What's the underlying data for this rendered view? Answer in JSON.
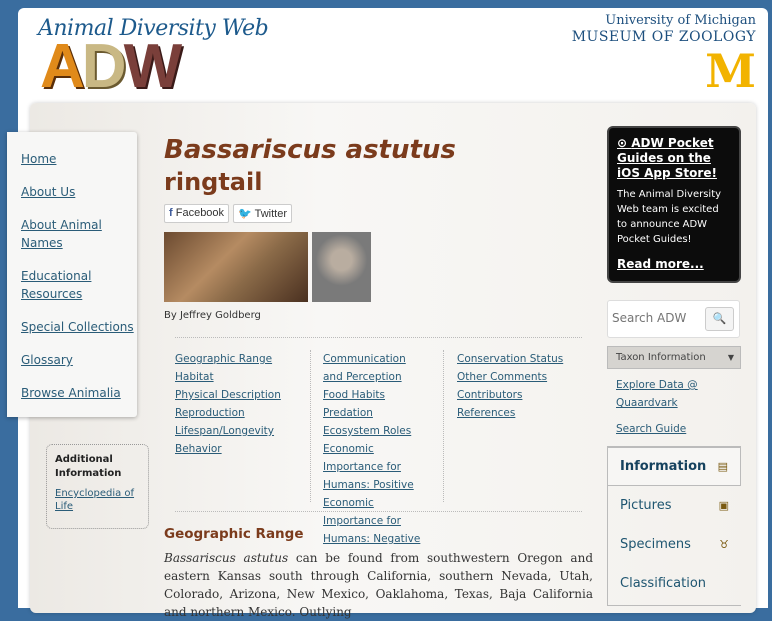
{
  "header": {
    "site_title": "Animal Diversity Web",
    "logo_letters": [
      "A",
      "D",
      "W"
    ],
    "university": "University of Michigan",
    "museum": "MUSEUM OF ZOOLOGY",
    "m_logo": "M"
  },
  "nav": [
    "Home",
    "About Us",
    "About Animal Names",
    "Educational Resources",
    "Special Collections",
    "Glossary",
    "Browse Animalia"
  ],
  "additional": {
    "title": "Additional Information",
    "link": "Encyclopedia of Life"
  },
  "species": {
    "scientific": "Bassariscus astutus",
    "common": "ringtail",
    "share": [
      "Facebook",
      "Twitter"
    ],
    "credit": "By Jeffrey Goldberg"
  },
  "toc": {
    "col1": [
      "Geographic Range",
      "Habitat",
      "Physical Description",
      "Reproduction",
      "Lifespan/Longevity",
      "Behavior"
    ],
    "col2": [
      "Communication and Perception",
      "Food Habits",
      "Predation",
      "Ecosystem Roles",
      "Economic Importance for Humans: Positive",
      "Economic Importance for Humans: Negative"
    ],
    "col3": [
      "Conservation Status",
      "Other Comments",
      "Contributors",
      "References"
    ]
  },
  "section": {
    "title": "Geographic Range",
    "lead": "Bassariscus astutus",
    "text": " can be found from southwestern Oregon and eastern Kansas south through California, southern Nevada, Utah, Colorado, Arizona, New Mexico, Oaklahoma, Texas, Baja California and northern Mexico. Outlying"
  },
  "promo": {
    "title": "ADW Pocket Guides on the iOS App Store!",
    "body": "The Animal Diversity Web team is excited to announce ADW Pocket Guides!",
    "more": "Read more..."
  },
  "search": {
    "placeholder": "Search ADW"
  },
  "taxon_select": "Taxon Information",
  "side_links": [
    "Explore Data @ Quaardvark",
    "Search Guide"
  ],
  "tabs": [
    "Information",
    "Pictures",
    "Specimens",
    "Classification"
  ]
}
